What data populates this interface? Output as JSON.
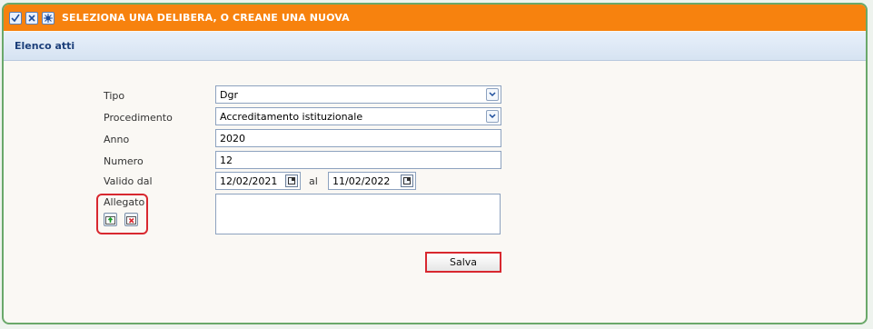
{
  "window": {
    "title": "SELEZIONA UNA DELIBERA, O CREANE UNA NUOVA",
    "icons": [
      "check-icon",
      "close-icon",
      "settings-icon"
    ]
  },
  "section": {
    "title": "Elenco atti"
  },
  "form": {
    "tipo": {
      "label": "Tipo",
      "value": "Dgr"
    },
    "procedimento": {
      "label": "Procedimento",
      "value": "Accreditamento istituzionale"
    },
    "anno": {
      "label": "Anno",
      "value": "2020"
    },
    "numero": {
      "label": "Numero",
      "value": "12"
    },
    "valido": {
      "label": "Valido dal",
      "from": "12/02/2021",
      "sep": "al",
      "to": "11/02/2022"
    },
    "allegato": {
      "label": "Allegato",
      "value": ""
    },
    "save_label": "Salva"
  },
  "colors": {
    "titlebar": "#f7820e",
    "highlight": "#d8282f",
    "section_text": "#1c3f7a"
  }
}
